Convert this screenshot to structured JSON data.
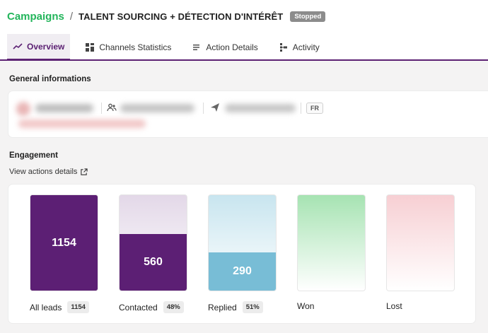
{
  "breadcrumb": {
    "root": "Campaigns",
    "separator": "/",
    "title": "TALENT SOURCING + DÉTECTION D'INTÉRÊT",
    "status": "Stopped"
  },
  "tabs": [
    {
      "label": "Overview",
      "icon": "trend-icon",
      "active": true
    },
    {
      "label": "Channels Statistics",
      "icon": "grid-icon",
      "active": false
    },
    {
      "label": "Action Details",
      "icon": "list-icon",
      "active": false
    },
    {
      "label": "Activity",
      "icon": "activity-icon",
      "active": false
    }
  ],
  "general": {
    "heading": "General informations",
    "language": "FR"
  },
  "engagement": {
    "heading": "Engagement",
    "view_link": "View actions details",
    "stages": [
      {
        "label": "All leads",
        "value": "1154",
        "badge": "1154",
        "fill_fraction": 1.0,
        "color": "#5c1f74"
      },
      {
        "label": "Contacted",
        "value": "560",
        "badge": "48%",
        "fill_fraction": 0.59,
        "color": "#5c1f74"
      },
      {
        "label": "Replied",
        "value": "290",
        "badge": "51%",
        "fill_fraction": 0.4,
        "color": "#78bdd6"
      },
      {
        "label": "Won",
        "value": "",
        "badge": "",
        "fill_fraction": 0,
        "color": "#a6e3b2"
      },
      {
        "label": "Lost",
        "value": "",
        "badge": "",
        "fill_fraction": 0,
        "color": "#f7cfd3"
      }
    ]
  },
  "colors": {
    "brand_purple": "#5c2173",
    "campaigns_green": "#23b55b",
    "status_grey": "#8c8c8c"
  }
}
